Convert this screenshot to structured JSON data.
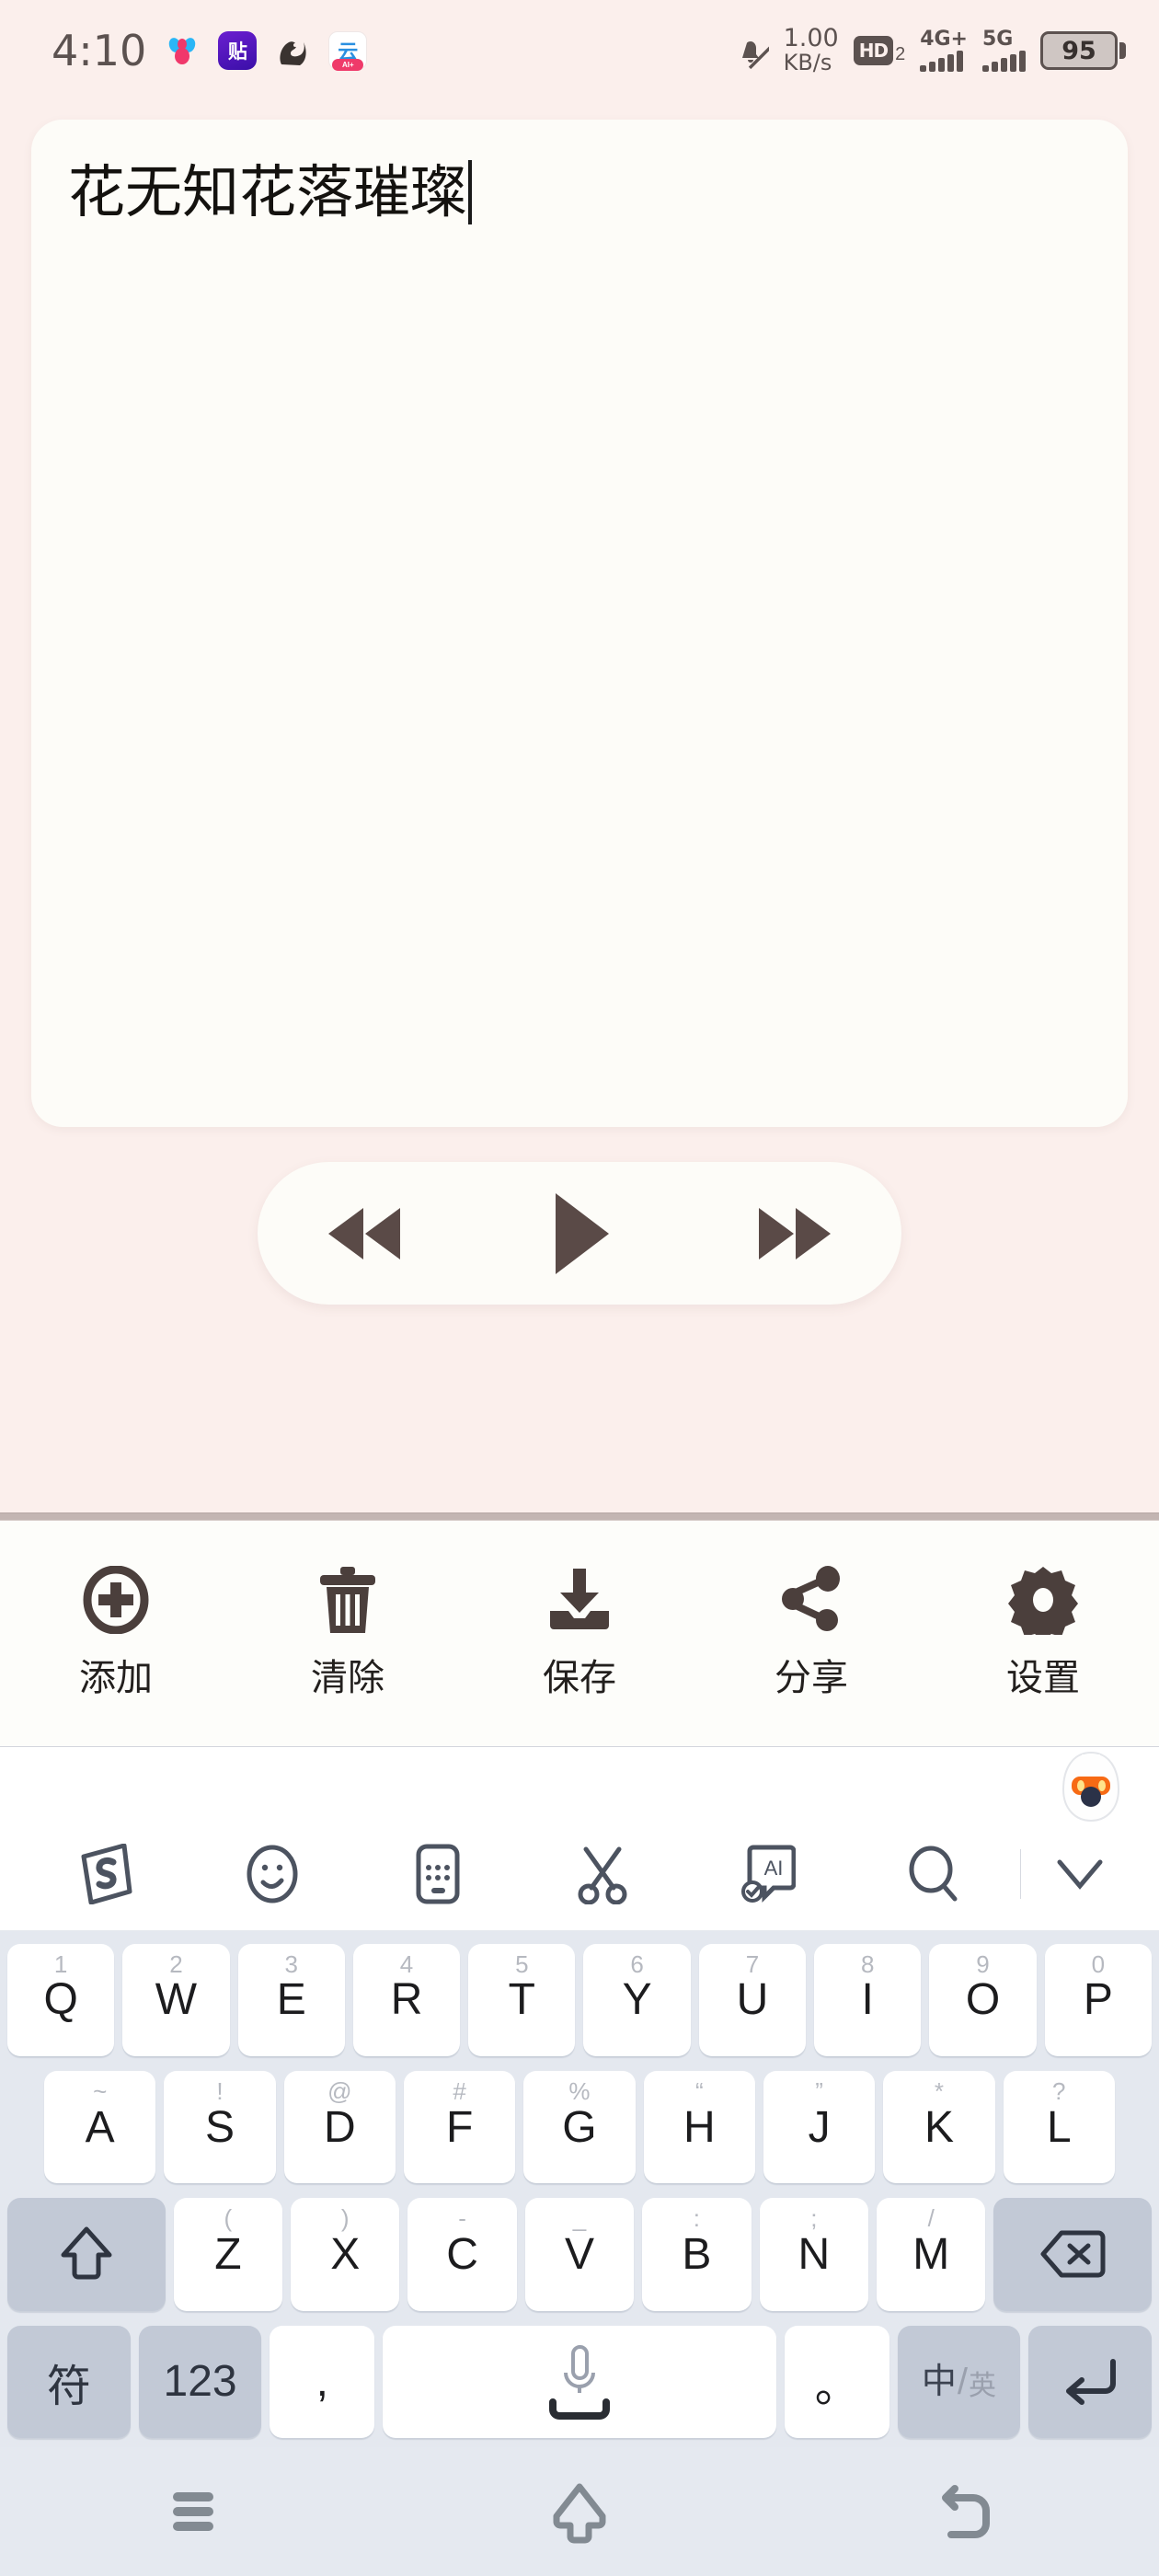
{
  "statusbar": {
    "clock": "4:10",
    "tray_icons": [
      {
        "name": "baidu-icon",
        "label": ""
      },
      {
        "name": "tieba-icon",
        "label": "贴"
      },
      {
        "name": "squirrel-icon",
        "label": "🐿"
      },
      {
        "name": "cloud-icon",
        "label": "云",
        "badge": "AI+"
      }
    ],
    "mute_icon": "bell-muted-icon",
    "network_speed_value": "1.00",
    "network_speed_unit": "KB/s",
    "volte": "HD",
    "volte_sub": "2",
    "sim1_label": "4G+",
    "sim2_label": "5G",
    "battery_percent": "95"
  },
  "editor": {
    "text": "花无知花落璀璨"
  },
  "player": {
    "prev_label": "rewind",
    "play_label": "play",
    "next_label": "fast-forward"
  },
  "toolbar": {
    "items": [
      {
        "icon": "add-circle-icon",
        "label": "添加"
      },
      {
        "icon": "trash-icon",
        "label": "清除"
      },
      {
        "icon": "download-save-icon",
        "label": "保存"
      },
      {
        "icon": "share-nodes-icon",
        "label": "分享"
      },
      {
        "icon": "gear-icon",
        "label": "设置"
      }
    ]
  },
  "keyboard": {
    "mascot": "sogou-mascot-icon",
    "toolbar_icons": [
      "sogou-logo-icon",
      "emoji-icon",
      "keyboard-layout-icon",
      "scissors-icon",
      "ai-text-icon",
      "search-icon",
      "chevron-down-icon"
    ],
    "row1": [
      {
        "key": "Q",
        "hint": "1"
      },
      {
        "key": "W",
        "hint": "2"
      },
      {
        "key": "E",
        "hint": "3"
      },
      {
        "key": "R",
        "hint": "4"
      },
      {
        "key": "T",
        "hint": "5"
      },
      {
        "key": "Y",
        "hint": "6"
      },
      {
        "key": "U",
        "hint": "7"
      },
      {
        "key": "I",
        "hint": "8"
      },
      {
        "key": "O",
        "hint": "9"
      },
      {
        "key": "P",
        "hint": "0"
      }
    ],
    "row2": [
      {
        "key": "A",
        "hint": "~"
      },
      {
        "key": "S",
        "hint": "!"
      },
      {
        "key": "D",
        "hint": "@"
      },
      {
        "key": "F",
        "hint": "#"
      },
      {
        "key": "G",
        "hint": "%"
      },
      {
        "key": "H",
        "hint": "“"
      },
      {
        "key": "J",
        "hint": "”"
      },
      {
        "key": "K",
        "hint": "*"
      },
      {
        "key": "L",
        "hint": "?"
      }
    ],
    "row3": [
      {
        "key": "Z",
        "hint": "("
      },
      {
        "key": "X",
        "hint": ")"
      },
      {
        "key": "C",
        "hint": "-"
      },
      {
        "key": "V",
        "hint": "_"
      },
      {
        "key": "B",
        "hint": ":"
      },
      {
        "key": "N",
        "hint": ";"
      },
      {
        "key": "M",
        "hint": "/"
      }
    ],
    "shift_label": "shift",
    "backspace_label": "backspace",
    "row4": {
      "symbols": "符",
      "numbers": "123",
      "comma": ",",
      "space_icon": "microphone-icon",
      "period": "。",
      "lang_zh": "中",
      "lang_slash": "/",
      "lang_en": "英",
      "enter": "enter"
    }
  },
  "navbar": {
    "recents": "recents-icon",
    "home": "home-icon",
    "back": "back-icon"
  }
}
